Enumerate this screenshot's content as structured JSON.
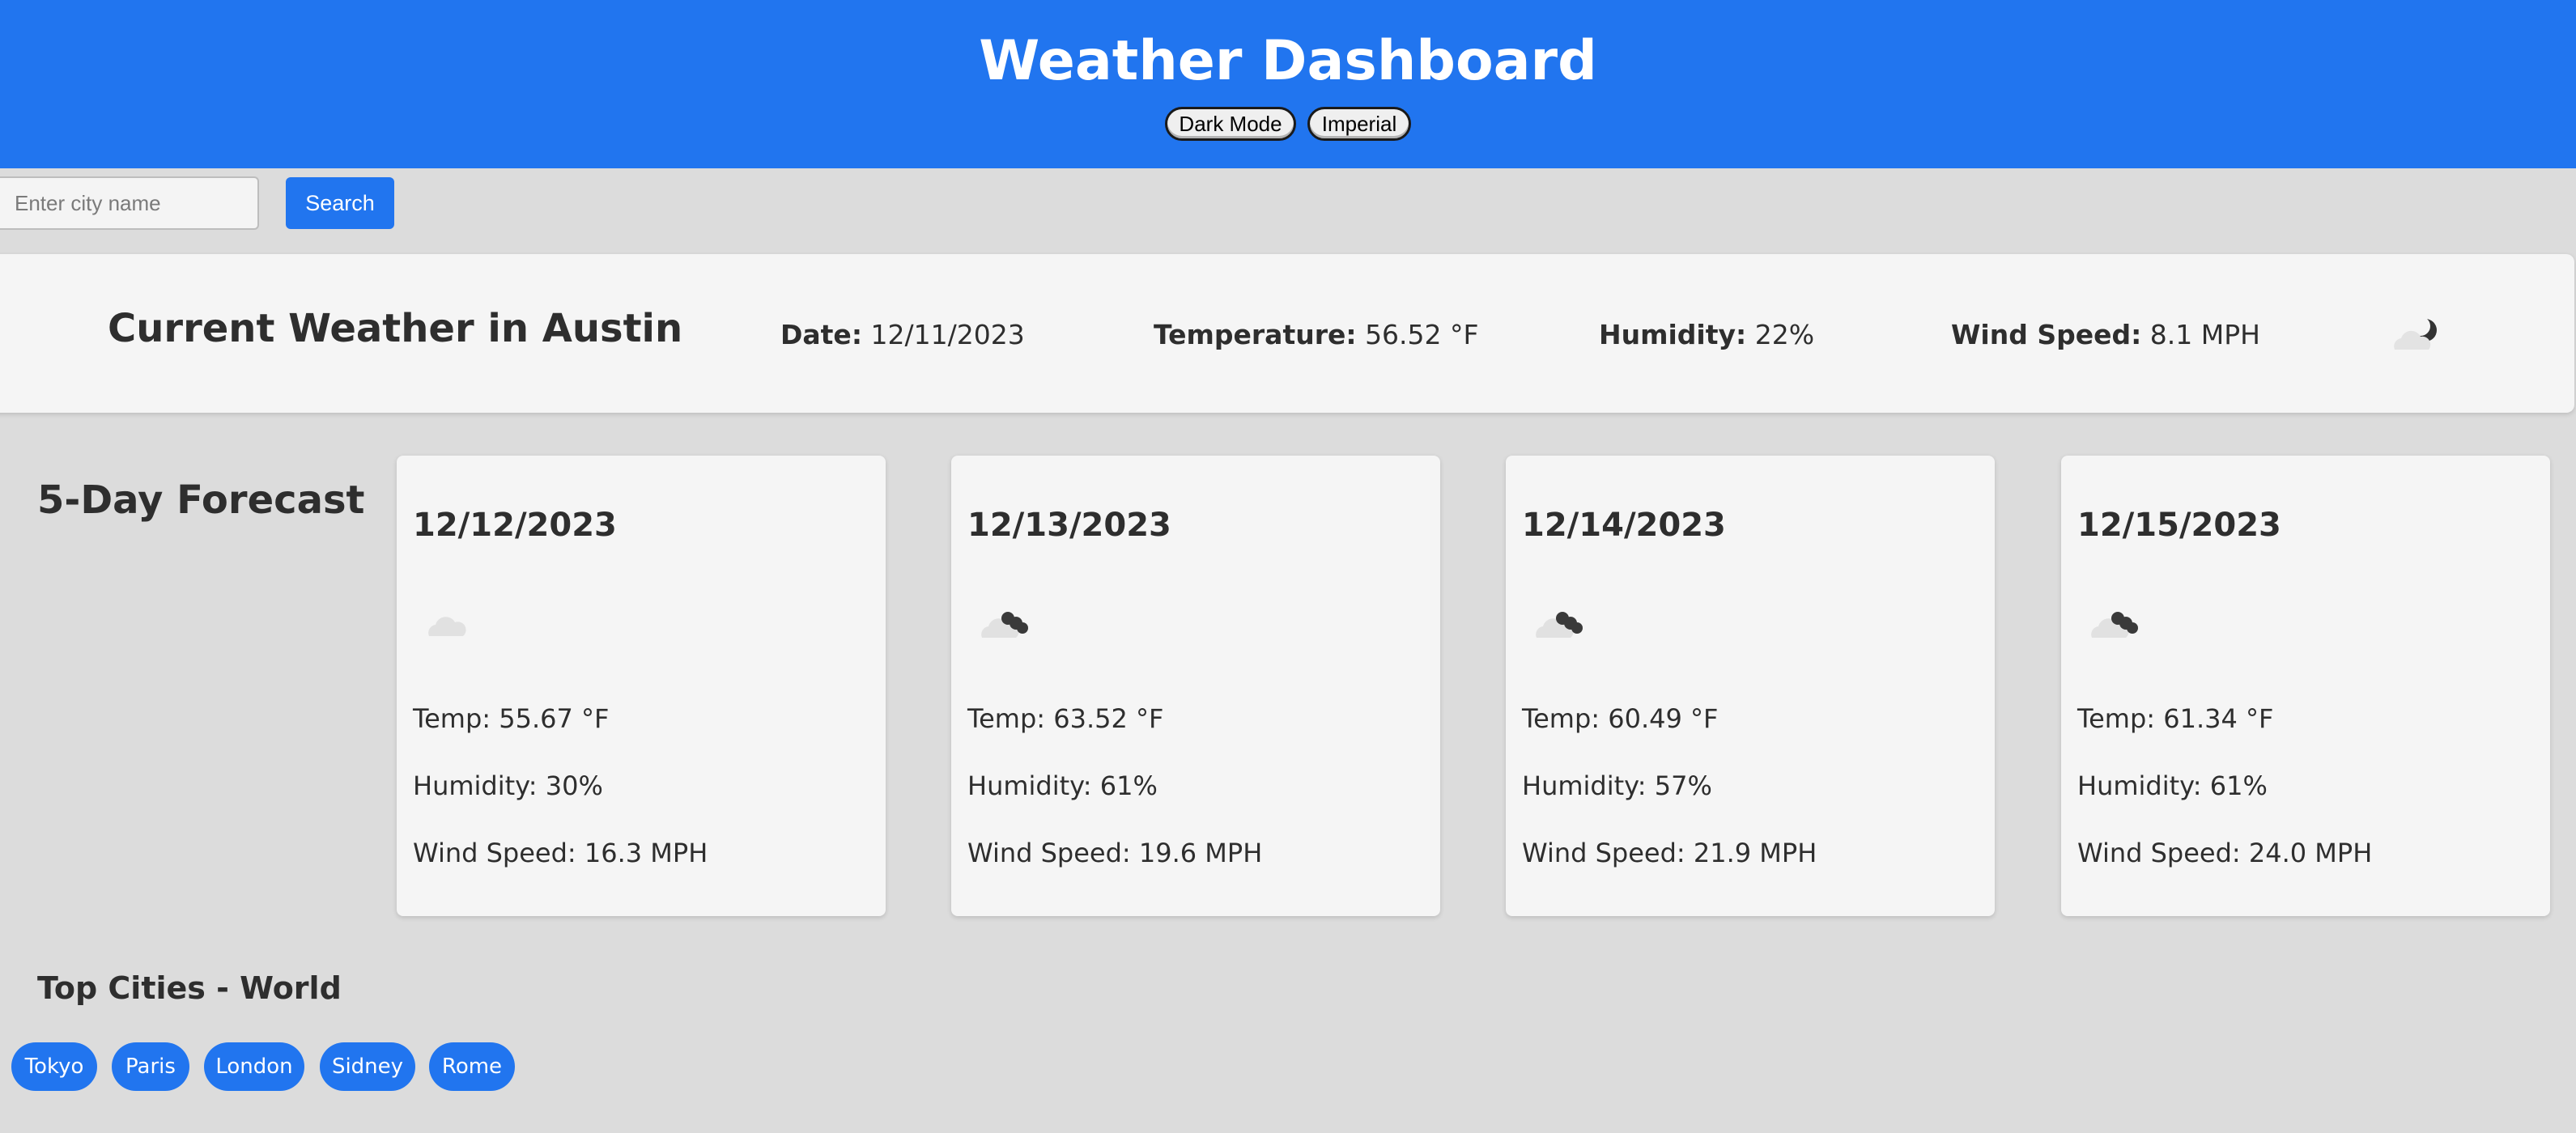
{
  "header": {
    "title": "Weather Dashboard",
    "dark_mode_label": "Dark Mode",
    "units_label": "Imperial",
    "background_color": "#2175ef"
  },
  "search": {
    "placeholder": "Enter city name",
    "value": "",
    "button_label": "Search"
  },
  "current": {
    "title": "Current Weather in Austin",
    "date_label": "Date:",
    "date_value": "12/11/2023",
    "temp_label": "Temperature:",
    "temp_value": "56.52 °F",
    "humidity_label": "Humidity:",
    "humidity_value": "22%",
    "wind_label": "Wind Speed:",
    "wind_value": "8.1 MPH",
    "icon": "partly-cloudy-night-icon"
  },
  "forecast": {
    "title": "5-Day Forecast",
    "days": [
      {
        "date": "12/12/2023",
        "icon": "cloud-icon",
        "temp": "Temp: 55.67 °F",
        "humidity": "Humidity: 30%",
        "wind": "Wind Speed: 16.3 MPH"
      },
      {
        "date": "12/13/2023",
        "icon": "broken-clouds-icon",
        "temp": "Temp: 63.52 °F",
        "humidity": "Humidity: 61%",
        "wind": "Wind Speed: 19.6 MPH"
      },
      {
        "date": "12/14/2023",
        "icon": "broken-clouds-icon",
        "temp": "Temp: 60.49 °F",
        "humidity": "Humidity: 57%",
        "wind": "Wind Speed: 21.9 MPH"
      },
      {
        "date": "12/15/2023",
        "icon": "broken-clouds-icon",
        "temp": "Temp: 61.34 °F",
        "humidity": "Humidity: 61%",
        "wind": "Wind Speed: 24.0 MPH"
      }
    ]
  },
  "top_cities": {
    "title": "Top Cities - World",
    "cities": [
      "Tokyo",
      "Paris",
      "London",
      "Sidney",
      "Rome"
    ]
  },
  "colors": {
    "accent": "#2175ef",
    "page_background": "#dcdcdc",
    "card_background": "#f5f5f5",
    "text": "#2e2e2e"
  }
}
